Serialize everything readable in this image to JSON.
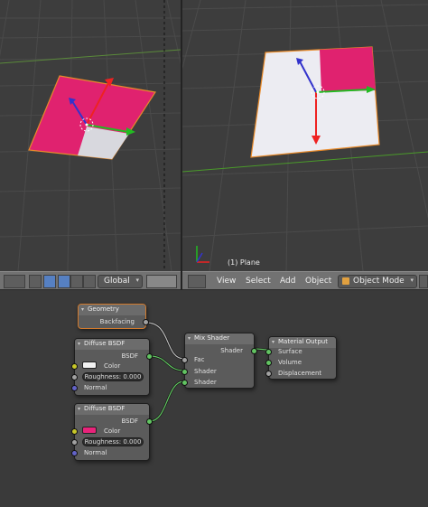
{
  "viewport_right": {
    "object_label": "(1) Plane"
  },
  "header_left": {
    "pivot_label": "Global",
    "icons": [
      "view-icon",
      "pivot-icon",
      "snap-icon",
      "manipulator-translate-icon",
      "manipulator-rotate-icon",
      "manipulator-scale-icon"
    ]
  },
  "header_right": {
    "menus": [
      "View",
      "Select",
      "Add",
      "Object"
    ],
    "mode": "Object Mode"
  },
  "nodes": {
    "geometry": {
      "title": "Geometry",
      "output": "Backfacing"
    },
    "diffuse1": {
      "title": "Diffuse BSDF",
      "output": "BSDF",
      "color_label": "Color",
      "roughness": "Roughness: 0.000",
      "normal": "Normal",
      "color": "#f2f2f2"
    },
    "diffuse2": {
      "title": "Diffuse BSDF",
      "output": "BSDF",
      "color_label": "Color",
      "roughness": "Roughness: 0.000",
      "normal": "Normal",
      "color": "#e8237a"
    },
    "mix": {
      "title": "Mix Shader",
      "output": "Shader",
      "fac": "Fac",
      "shader1": "Shader",
      "shader2": "Shader"
    },
    "output": {
      "title": "Material Output",
      "surface": "Surface",
      "volume": "Volume",
      "displacement": "Displacement"
    }
  },
  "colors": {
    "magenta": "#e0226f",
    "white_face": "#ececf2",
    "selection_outline": "#e88a2a"
  }
}
